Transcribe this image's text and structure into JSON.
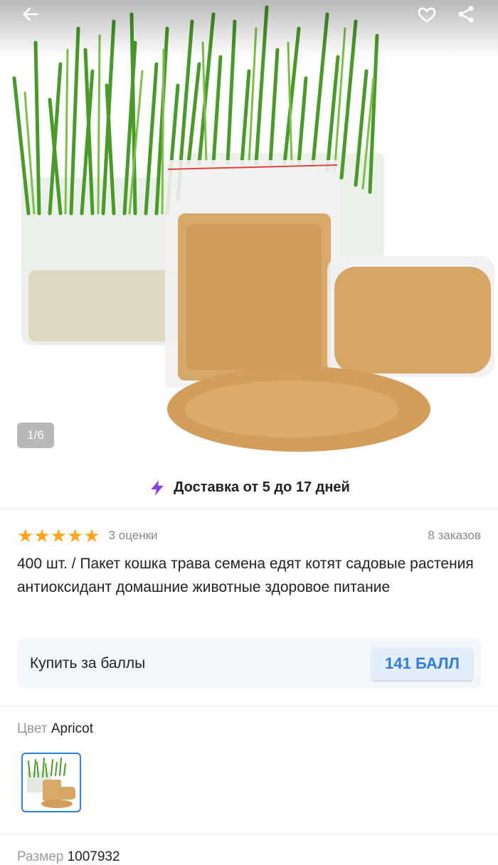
{
  "gallery": {
    "counter": "1/6",
    "image_alt": "product photo: cat grass growing in trays and bags of seeds"
  },
  "delivery": {
    "text": "Доставка от 5 до 17 дней"
  },
  "rating": {
    "stars": 5,
    "ratings_text": "3 оценки",
    "orders_text": "8 заказов"
  },
  "product": {
    "title": "400 шт. / Пакет кошка трава семена едят котят садовые растения антиоксидант домашние животные здоровое питание"
  },
  "points": {
    "label": "Купить за баллы",
    "button": "141 БАЛЛ"
  },
  "color": {
    "label": "Цвет",
    "value": "Apricot"
  },
  "size": {
    "label": "Размер",
    "value": "1007932"
  },
  "colors": {
    "accent": "#2f7de1",
    "star": "#ffa41c",
    "bolt": "#8a3fe0"
  }
}
